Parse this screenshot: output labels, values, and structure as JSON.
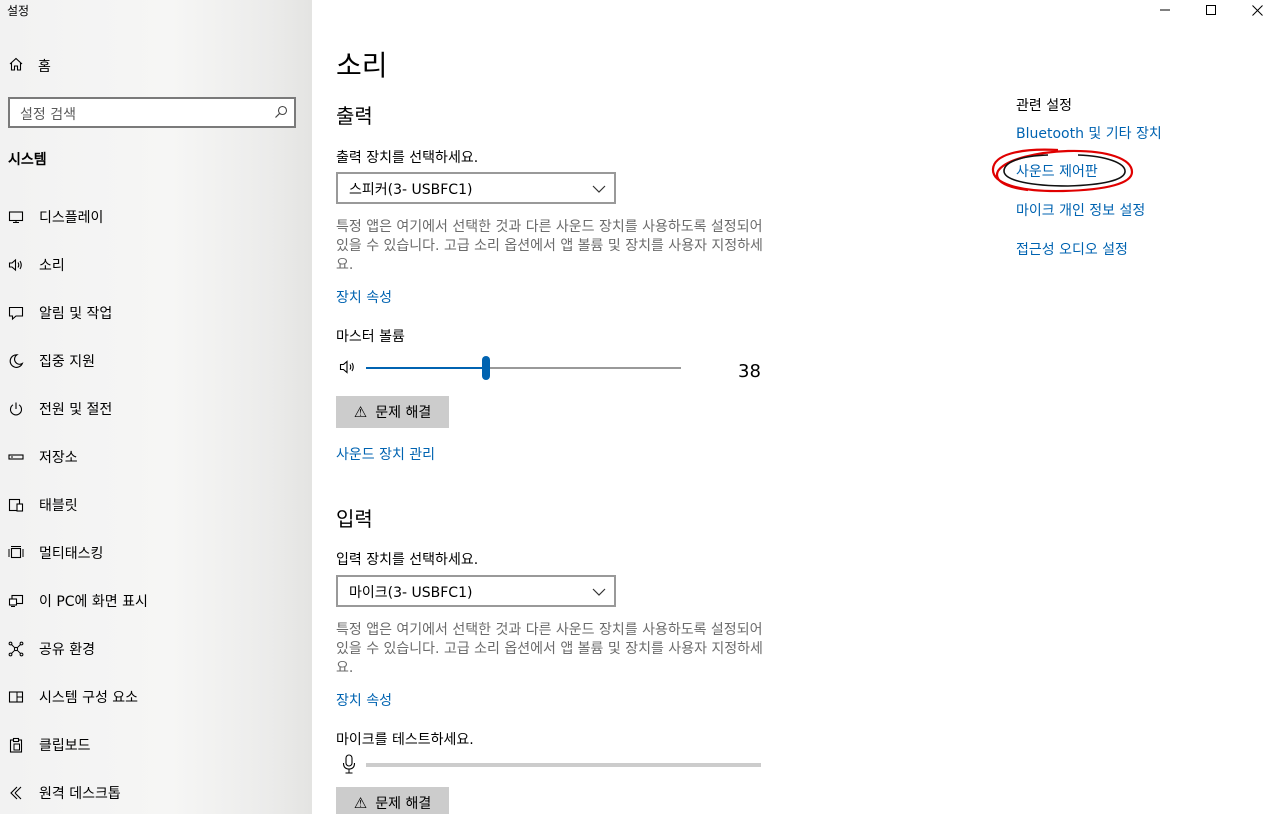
{
  "window": {
    "title": "설정",
    "minimize_glyph": "—",
    "maximize_glyph": "☐",
    "close_glyph": "✕"
  },
  "sidebar": {
    "home_label": "홈",
    "search_placeholder": "설정 검색",
    "section_title": "시스템",
    "items": [
      {
        "label": "디스플레이",
        "icon": "monitor-icon"
      },
      {
        "label": "소리",
        "icon": "speaker-icon"
      },
      {
        "label": "알림 및 작업",
        "icon": "chat-bubble-icon"
      },
      {
        "label": "집중 지원",
        "icon": "moon-icon"
      },
      {
        "label": "전원 및 절전",
        "icon": "power-icon"
      },
      {
        "label": "저장소",
        "icon": "storage-icon"
      },
      {
        "label": "태블릿",
        "icon": "tablet-icon"
      },
      {
        "label": "멀티태스킹",
        "icon": "multitasking-icon"
      },
      {
        "label": "이 PC에 화면 표시",
        "icon": "project-icon"
      },
      {
        "label": "공유 환경",
        "icon": "share-icon"
      },
      {
        "label": "시스템 구성 요소",
        "icon": "components-icon"
      },
      {
        "label": "클립보드",
        "icon": "clipboard-icon"
      },
      {
        "label": "원격 데스크톱",
        "icon": "remote-desktop-icon"
      }
    ]
  },
  "main": {
    "title": "소리",
    "output": {
      "heading": "출력",
      "select_label": "출력 장치를 선택하세요.",
      "device": "스피커(3- USBFC1)",
      "description": "특정 앱은 여기에서 선택한 것과 다른 사운드 장치를 사용하도록 설정되어 있을 수 있습니다. 고급 소리 옵션에서 앱 볼륨 및 장치를 사용자 지정하세요.",
      "device_properties_link": "장치 속성",
      "master_volume_label": "마스터 볼륨",
      "volume": 38,
      "volume_max": 100,
      "troubleshoot_label": "문제 해결",
      "manage_devices_link": "사운드 장치 관리"
    },
    "input": {
      "heading": "입력",
      "select_label": "입력 장치를 선택하세요.",
      "device": "마이크(3- USBFC1)",
      "description": "특정 앱은 여기에서 선택한 것과 다른 사운드 장치를 사용하도록 설정되어 있을 수 있습니다. 고급 소리 옵션에서 앱 볼륨 및 장치를 사용자 지정하세요.",
      "device_properties_link": "장치 속성",
      "test_label": "마이크를 테스트하세요.",
      "mic_level": 0,
      "troubleshoot_label": "문제 해결"
    }
  },
  "related": {
    "heading": "관련 설정",
    "links": [
      "Bluetooth 및 기타 장치",
      "사운드 제어판",
      "마이크 개인 정보 설정",
      "접근성 오디오 설정"
    ]
  },
  "colors": {
    "accent": "#0063b1",
    "annotation_circle": "#e00000"
  }
}
